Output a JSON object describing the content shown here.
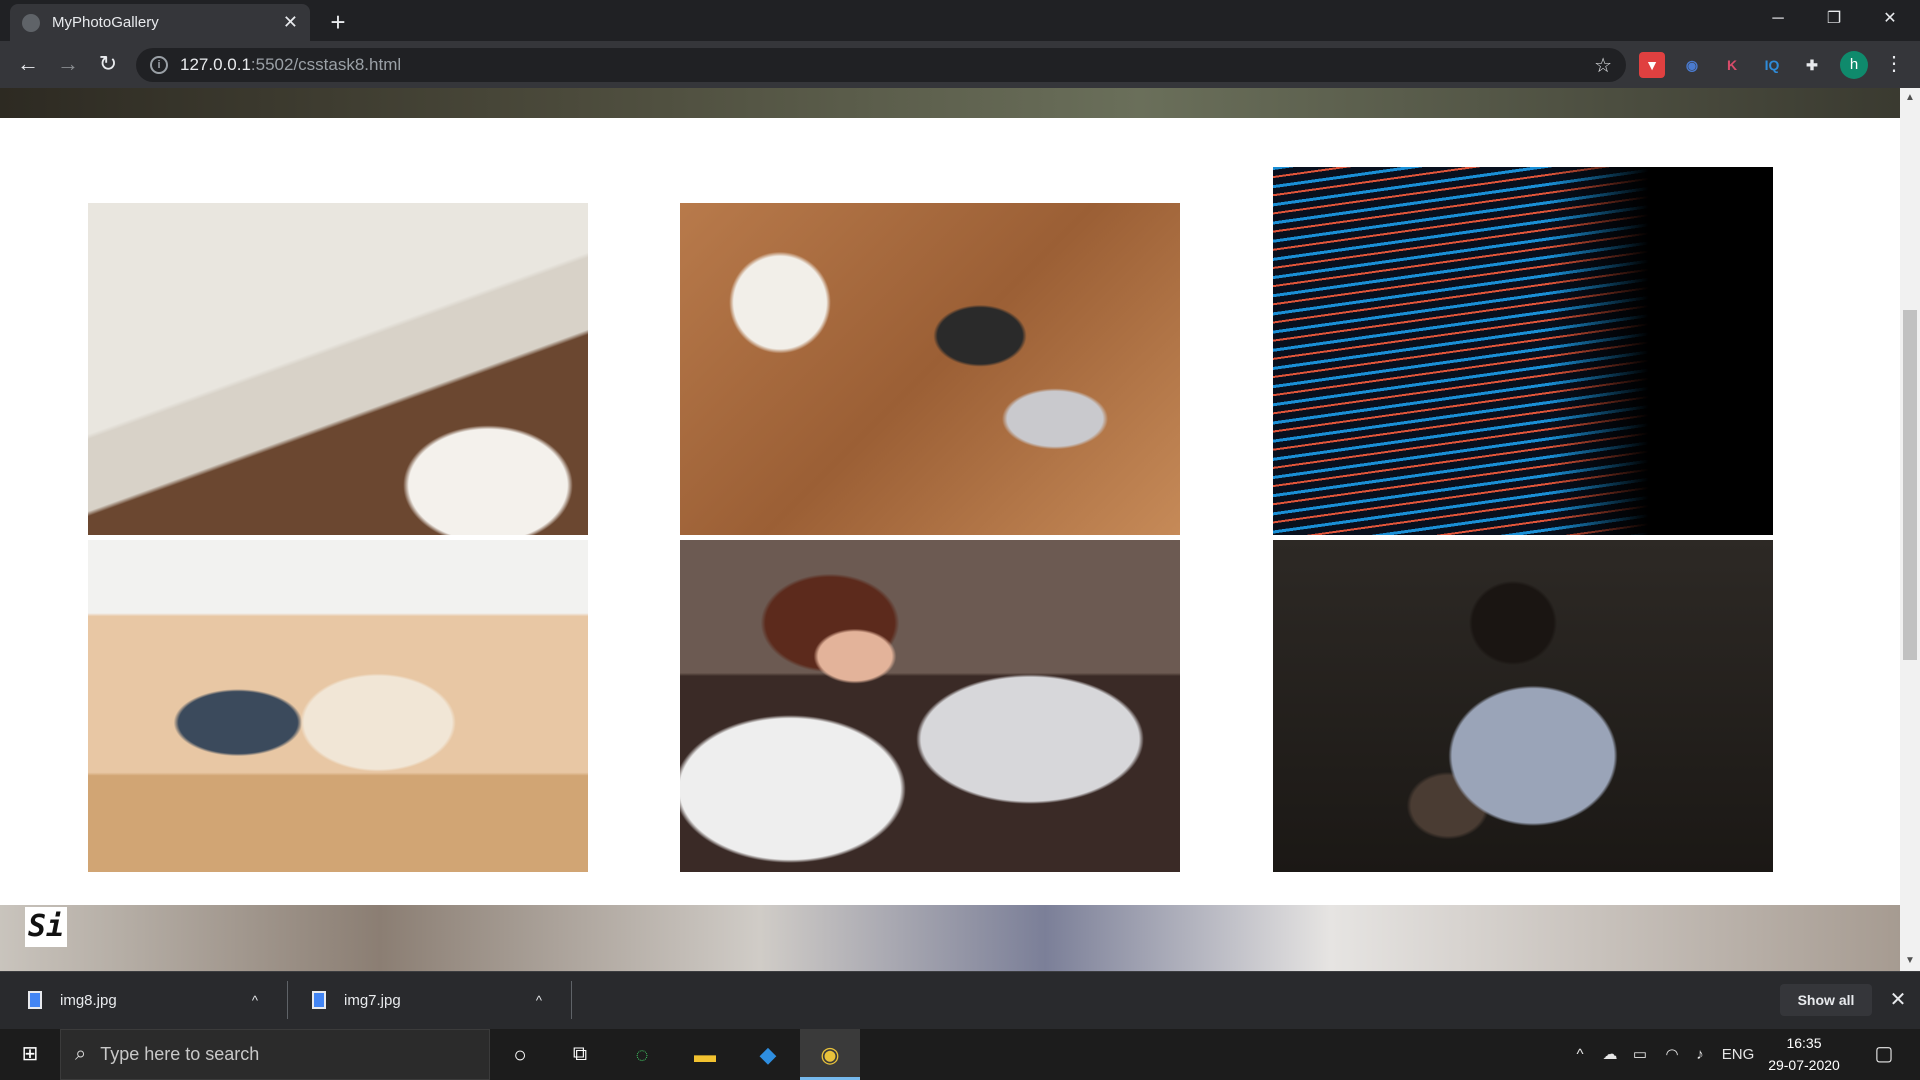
{
  "browser": {
    "tab_title": "MyPhotoGallery",
    "tab_close": "✕",
    "new_tab": "+",
    "window_controls": {
      "minimize": "─",
      "restore": "❐",
      "close": "✕"
    },
    "nav": {
      "back": "←",
      "forward": "→",
      "reload": "↻"
    },
    "url_host": "127.0.0.1",
    "url_path": ":5502/csstask8.html",
    "bookmark_icon": "☆",
    "extensions": [
      {
        "name": "pocket-icon",
        "glyph": "▼",
        "color": "#e04040"
      },
      {
        "name": "grammarly-icon",
        "glyph": "◉",
        "color": "#4a7bd0"
      },
      {
        "name": "k-extension-icon",
        "glyph": "K",
        "color": "#d84c6a"
      },
      {
        "name": "iq-extension-icon",
        "glyph": "IQ",
        "color": "#2f8bd8"
      },
      {
        "name": "extensions-puzzle-icon",
        "glyph": "✚",
        "color": "#e8eaed"
      }
    ],
    "profile_initial": "h",
    "menu_icon": "⋮"
  },
  "page": {
    "gallery": [
      {
        "name": "planner-notebook-photo"
      },
      {
        "name": "team-meeting-desk-photo"
      },
      {
        "name": "code-screen-photo"
      },
      {
        "name": "masked-students-photo"
      },
      {
        "name": "smiling-laptop-woman-photo"
      },
      {
        "name": "reading-woman-photo"
      }
    ],
    "section_heading_partial": "Si"
  },
  "downloads": {
    "items": [
      {
        "filename": "img8.jpg",
        "chevron": "^"
      },
      {
        "filename": "img7.jpg",
        "chevron": "^"
      }
    ],
    "show_all": "Show all",
    "close": "✕"
  },
  "taskbar": {
    "search_placeholder": "Type here to search",
    "tray": {
      "language": "ENG"
    },
    "time": "16:35",
    "date": "29-07-2020"
  }
}
